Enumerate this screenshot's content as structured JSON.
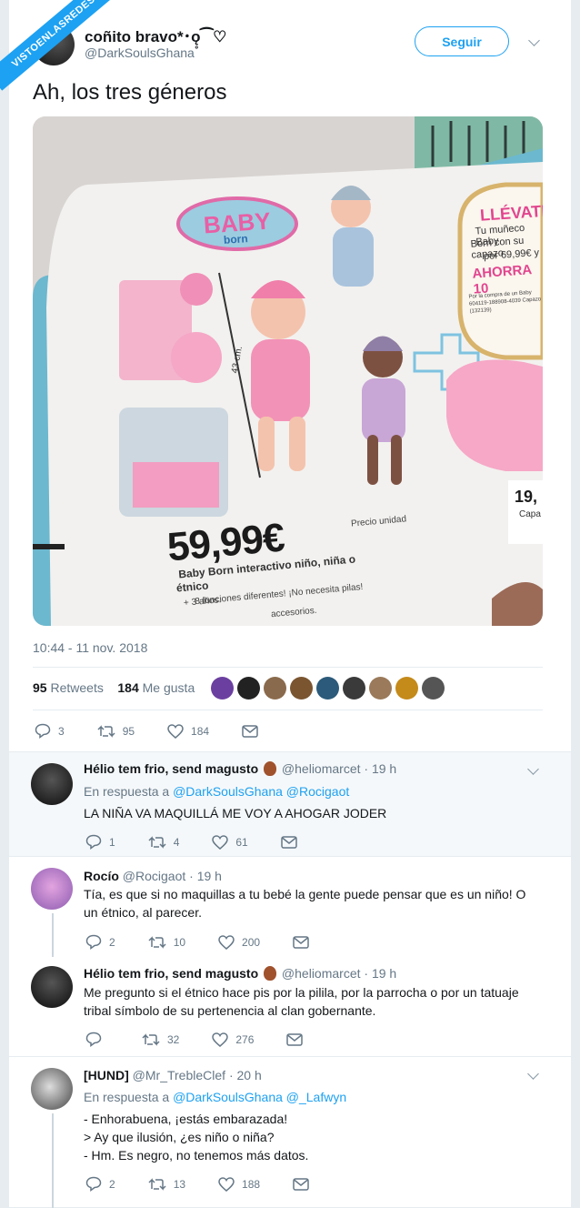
{
  "watermark": "VISTOENLASREDES",
  "tweet": {
    "author_name": "coñito bravo*･ǫ̥⁀♡",
    "author_handle": "@DarkSoulsGhana",
    "follow_label": "Seguir",
    "text": "Ah, los tres géneros",
    "timestamp": "10:44 - 11 nov. 2018",
    "retweets_count": "95",
    "retweets_label": "Retweets",
    "likes_count": "184",
    "likes_label": "Me gusta",
    "actions": {
      "replies": "3",
      "retweets": "95",
      "likes": "184"
    },
    "photo": {
      "brand_top": "BABY",
      "brand_bottom": "born",
      "promo_title": "LLÉVATE",
      "promo_line1": "Tu muñeco Baby",
      "promo_line2": "Born con su capazo",
      "promo_line3": "por 69,99€ y",
      "promo_line4": "AHORRA 10",
      "promo_small": "Por la compra de un Baby 604119-188908-4039 Capazo (132139)",
      "height_label": "43 cm.",
      "price": "59,99€",
      "price_unit": "Precio unidad",
      "product_name": "Baby Born interactivo niño, niña o",
      "product_name2": "étnico",
      "age": "+ 3 años.",
      "features": "8 funciones diferentes! ¡No necesita pilas!",
      "features2": "accesorios.",
      "side_price": "19,",
      "side_text": "Capa"
    }
  },
  "replies": [
    {
      "name": "Hélio tem frio, send magusto",
      "handle": "@heliomarcet",
      "time": "· 19 h",
      "in_reply_label": "En respuesta a",
      "in_reply_to": "@DarkSoulsGhana @Rocigaot",
      "text": "LA NIÑA VA MAQUILLÁ ME VOY A AHOGAR JODER",
      "replies": "1",
      "retweets": "4",
      "likes": "61"
    },
    {
      "name": "Rocío",
      "handle": "@Rocigaot",
      "time": "· 19 h",
      "text": "Tía, es que si no maquillas a tu bebé la gente puede pensar que es un niño! O un étnico, al parecer.",
      "replies": "2",
      "retweets": "10",
      "likes": "200"
    },
    {
      "name": "Hélio tem frio, send magusto",
      "handle": "@heliomarcet",
      "time": "· 19 h",
      "text": "Me pregunto si el étnico hace pis por la pilila, por la parrocha o por un tatuaje tribal símbolo de su pertenencia al clan gobernante.",
      "replies": "",
      "retweets": "32",
      "likes": "276"
    },
    {
      "name": "[HUND]",
      "handle": "@Mr_TrebleClef",
      "time": "· 20 h",
      "in_reply_label": "En respuesta a",
      "in_reply_to": "@DarkSoulsGhana @_Lafwyn",
      "text_lines": [
        "- Enhorabuena, ¡estás embarazada!",
        "> Ay que ilusión, ¿es niño o niña?",
        "- Hm. Es negro, no tenemos más datos."
      ],
      "replies": "2",
      "retweets": "13",
      "likes": "188"
    }
  ],
  "colors": {
    "accent": "#1da1f2",
    "muted": "#657786",
    "like_red": "#e0245e"
  }
}
